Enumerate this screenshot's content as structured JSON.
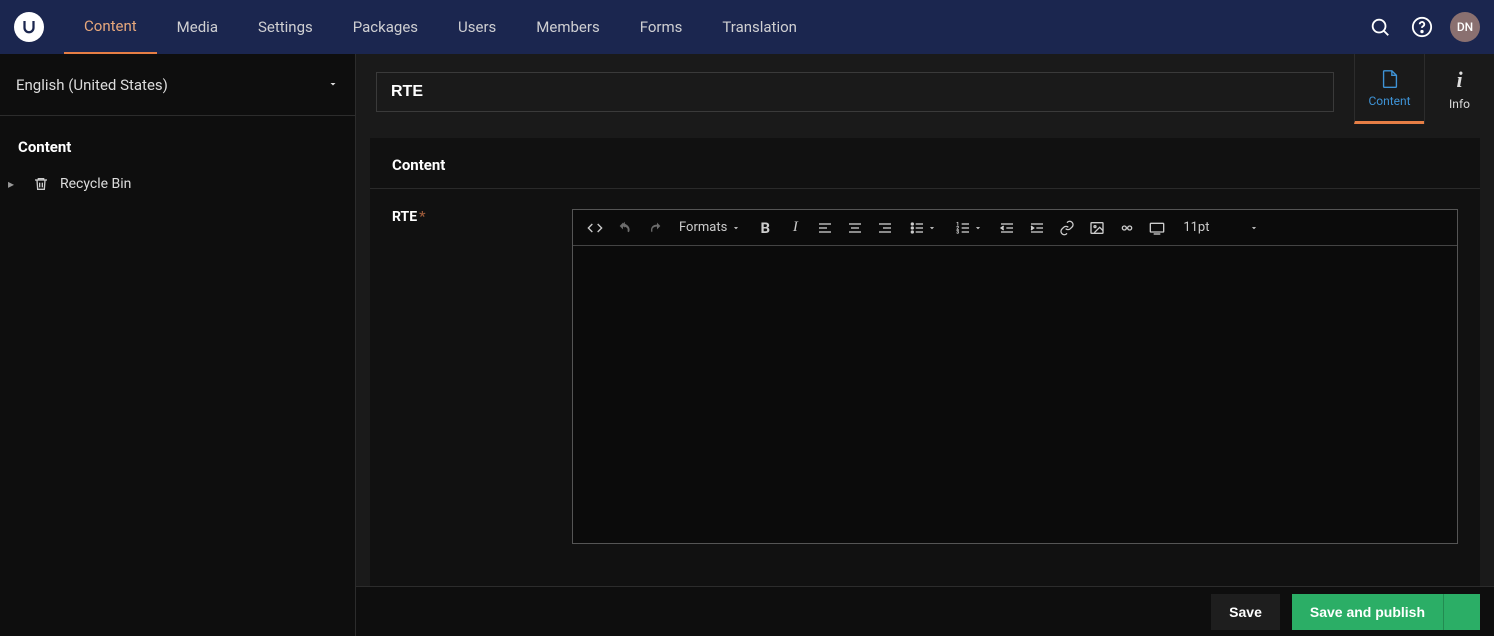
{
  "nav": {
    "items": [
      "Content",
      "Media",
      "Settings",
      "Packages",
      "Users",
      "Members",
      "Forms",
      "Translation"
    ],
    "activeIndex": 0
  },
  "user": {
    "initials": "DN"
  },
  "sidebar": {
    "language": "English (United States)",
    "treeHeader": "Content",
    "recycleBin": "Recycle Bin"
  },
  "document": {
    "title": "RTE",
    "apps": {
      "content": "Content",
      "info": "Info"
    },
    "group": {
      "title": "Content"
    },
    "property": {
      "label": "RTE",
      "required": "*"
    },
    "rte": {
      "formats": "Formats",
      "fontSize": "11pt"
    }
  },
  "footer": {
    "save": "Save",
    "publish": "Save and publish"
  }
}
